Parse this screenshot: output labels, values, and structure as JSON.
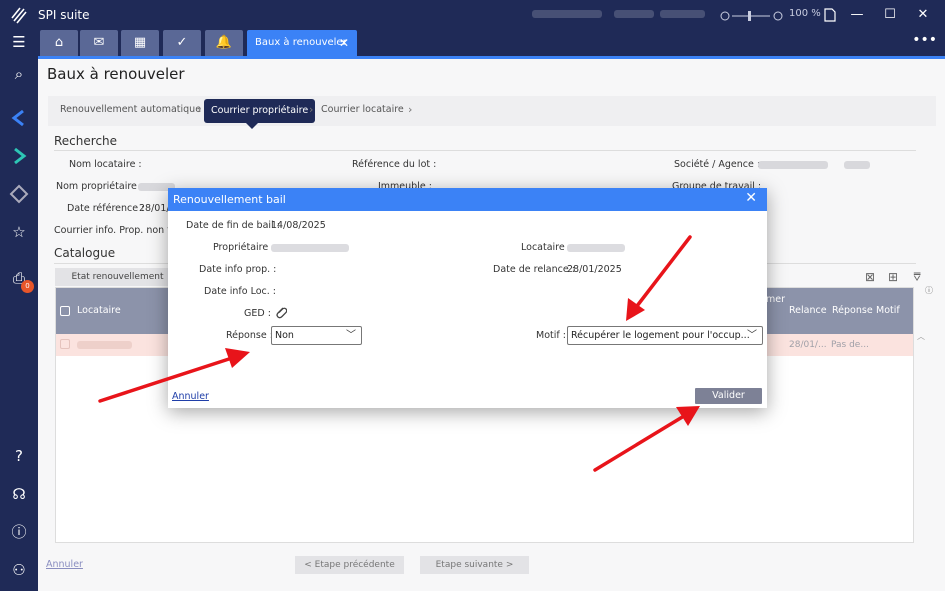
{
  "app": {
    "name": "SPI suite",
    "zoom": "100 %"
  },
  "tabs": [
    {
      "icon": "home-icon",
      "glyph": "⌂"
    },
    {
      "icon": "mail-icon",
      "glyph": "✉"
    },
    {
      "icon": "calendar-icon",
      "glyph": "▦"
    },
    {
      "icon": "check-icon",
      "glyph": "✓"
    },
    {
      "icon": "bell-icon",
      "glyph": "🔔"
    }
  ],
  "active_tab": {
    "label": "Baux à renouveler",
    "close": "✕"
  },
  "page": {
    "title": "Baux à renouveler"
  },
  "steps": [
    "Renouvellement automatique",
    "Courrier propriétaire",
    "Courrier locataire"
  ],
  "search": {
    "title": "Recherche",
    "fields": {
      "nom_locataire": "Nom locataire :",
      "nom_proprietaire": "Nom propriétaire :",
      "date_reference": "Date référence :",
      "date_reference_value": "28/01/",
      "courrier_info": "Courrier info. Prop. non fait",
      "reference_lot": "Référence du lot :",
      "immeuble": "Immeuble :",
      "societe_agence": "Société / Agence :",
      "groupe_travail": "Groupe de travail :"
    }
  },
  "catalogue": {
    "title": "Catalogue",
    "tab": "Etat renouvellement",
    "columns": {
      "locataire": "Locataire",
      "mer": "mer",
      "relance": "Relance",
      "reponse": "Réponse",
      "motif": "Motif"
    },
    "row": {
      "relance": "28/01/...",
      "reponse": "Pas de..."
    }
  },
  "footer": {
    "annuler": "Annuler",
    "prev": "< Etape précédente",
    "next": "Etape suivante >"
  },
  "modal": {
    "title": "Renouvellement bail",
    "close": "✕",
    "date_fin_bail_label": "Date de fin de bail :",
    "date_fin_bail": "14/08/2025",
    "proprietaire_label": "Propriétaire :",
    "locataire_label": "Locataire :",
    "date_info_prop_label": "Date info prop. :",
    "date_relance_label": "Date de relance :",
    "date_relance": "28/01/2025",
    "date_info_loc_label": "Date info Loc. :",
    "ged_label": "GED :",
    "reponse_label": "Réponse :",
    "reponse_value": "Non",
    "motif_label": "Motif :",
    "motif_value": "Récupérer le logement pour l'occup...",
    "annuler": "Annuler",
    "valider": "Valider"
  },
  "colors": {
    "navy": "#1f2a57",
    "accent": "#3b82f6",
    "badge": "#e8562a",
    "arrow": "#e8141a"
  },
  "nav_badge": "0"
}
